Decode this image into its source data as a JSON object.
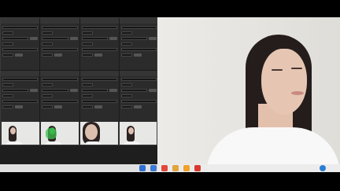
{
  "app": {
    "panels": [
      {
        "title": "",
        "rows": 6
      },
      {
        "title": "",
        "rows": 6
      },
      {
        "title": "",
        "rows": 6
      },
      {
        "title": "",
        "rows": 6
      },
      {
        "title": "",
        "rows": 6
      },
      {
        "title": "",
        "rows": 6
      },
      {
        "title": "",
        "rows": 6
      },
      {
        "title": "",
        "rows": 6
      }
    ],
    "thumbnails": [
      {
        "kind": "portrait"
      },
      {
        "kind": "face-mask"
      },
      {
        "kind": "closeup"
      },
      {
        "kind": "portrait"
      }
    ]
  },
  "taskbar": {
    "icons": [
      {
        "name": "task-view-icon",
        "color": "#2f6fd4"
      },
      {
        "name": "file-explorer-icon",
        "color": "#3b7ad6"
      },
      {
        "name": "app-red-icon",
        "color": "#e2473c"
      },
      {
        "name": "chrome-icon",
        "color": "#e2a43c"
      },
      {
        "name": "app-orange-icon",
        "color": "#f0a22a"
      },
      {
        "name": "app-red2-icon",
        "color": "#d63b2f"
      }
    ]
  }
}
